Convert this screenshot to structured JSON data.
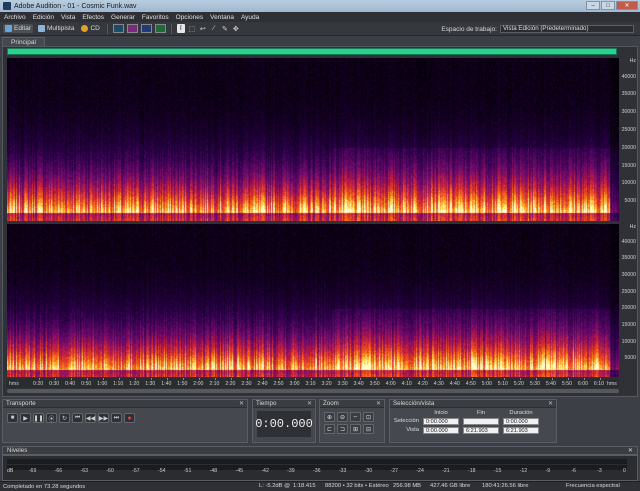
{
  "window": {
    "title": "Adobe Audition - 01 - Cosmic Funk.wav",
    "minimize": "–",
    "maximize": "□",
    "close": "✕"
  },
  "menu": [
    "Archivo",
    "Edición",
    "Vista",
    "Efectos",
    "Generar",
    "Favoritos",
    "Opciones",
    "Ventana",
    "Ayuda"
  ],
  "toolbar": {
    "edit_label": "Editar",
    "multitrack_label": "Multipista",
    "cd_label": "CD",
    "workspace_label": "Espacio de trabajo:",
    "workspace_value": "Vista Edición (Predeterminado)"
  },
  "main_panel": {
    "tab_label": "Principal",
    "hz_unit": "Hz",
    "hz_ticks": [
      "40000",
      "35000",
      "30000",
      "25000",
      "20000",
      "15000",
      "10000",
      "5000"
    ],
    "time_unit": "hms",
    "time_ticks": [
      "0:20",
      "0:30",
      "0:40",
      "0:50",
      "1:00",
      "1:10",
      "1:20",
      "1:30",
      "1:40",
      "1:50",
      "2:00",
      "2:10",
      "2:20",
      "2:30",
      "2:40",
      "2:50",
      "3:00",
      "3:10",
      "3:20",
      "3:30",
      "3:40",
      "3:50",
      "4:00",
      "4:10",
      "4:20",
      "4:30",
      "4:40",
      "4:50",
      "5:00",
      "5:10",
      "5:20",
      "5:30",
      "5:40",
      "5:50",
      "6:00",
      "6:10"
    ]
  },
  "transport": {
    "title": "Transporte",
    "close": "✕"
  },
  "time_panel": {
    "title": "Tiempo",
    "close": "✕",
    "value": "0:00.000"
  },
  "zoom_panel": {
    "title": "Zoom",
    "close": "✕"
  },
  "selection_panel": {
    "title": "Selección/vista",
    "close": "✕",
    "col_start": "Inicio",
    "col_end": "Fin",
    "col_duration": "Duración",
    "row_selection": "Selección",
    "row_view": "Vista",
    "sel_start": "0:00.000",
    "sel_end": "",
    "sel_duration": "0:00.000",
    "view_start": "0:00.000",
    "view_end": "6:21.903",
    "view_duration": "6:21.903"
  },
  "levels": {
    "title": "Niveles",
    "close": "✕",
    "scale": [
      "dB",
      "-69",
      "-66",
      "-63",
      "-60",
      "-57",
      "-54",
      "-51",
      "-48",
      "-45",
      "-42",
      "-39",
      "-36",
      "-33",
      "-30",
      "-27",
      "-24",
      "-21",
      "-18",
      "-15",
      "-12",
      "-9",
      "-6",
      "-3",
      "0"
    ]
  },
  "status": {
    "left": "Completado en 73.28 segundos",
    "db": "L: -5.2dB @",
    "position": "1:18.415",
    "format": "88200 • 32 bits • Estéreo",
    "size": "256.98 MB",
    "free": "427.46 GB libre",
    "free_time": "180:41:26.56 libre",
    "view_mode": "Frecuencia espectral"
  }
}
